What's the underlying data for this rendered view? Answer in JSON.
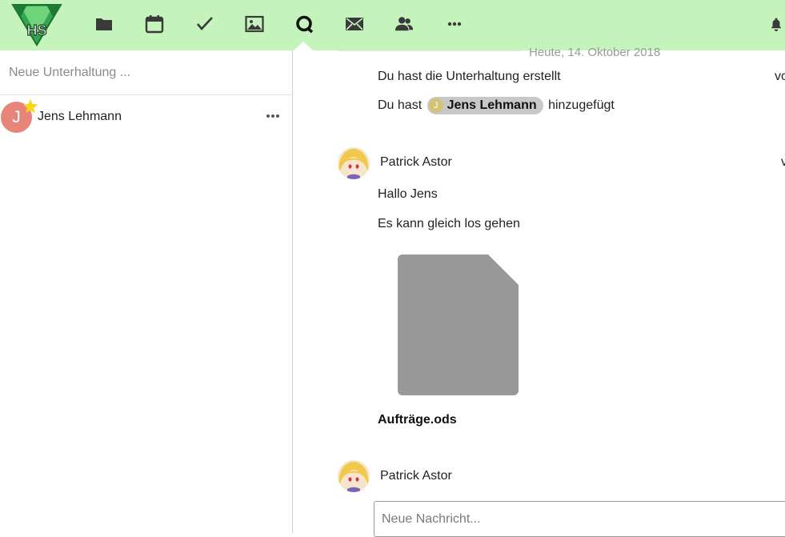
{
  "header": {
    "logo_text": "HS",
    "nav": [
      {
        "name": "files",
        "icon": "folder-icon"
      },
      {
        "name": "calendar",
        "icon": "calendar-icon"
      },
      {
        "name": "tasks",
        "icon": "checkmark-icon"
      },
      {
        "name": "gallery",
        "icon": "image-icon"
      },
      {
        "name": "talk",
        "icon": "talk-icon",
        "active": true
      },
      {
        "name": "mail",
        "icon": "mail-icon"
      },
      {
        "name": "contacts",
        "icon": "contacts-icon"
      },
      {
        "name": "more",
        "icon": "more-icon"
      }
    ],
    "notifications_icon": "bell-icon",
    "colors": {
      "header_bg": "#c4f4bb",
      "icon": "#3a3a3a"
    }
  },
  "sidebar": {
    "new_conversation_placeholder": "Neue Unterhaltung ...",
    "conversations": [
      {
        "avatar_letter": "J",
        "name": "Jens Lehmann",
        "favorite": true,
        "avatar_color": "#e8857a"
      }
    ]
  },
  "chat": {
    "date_separator": "Heute, 14. Oktober 2018",
    "system_messages": [
      {
        "text": "Du hast die Unterhaltung erstellt",
        "right_cut": "vo"
      },
      {
        "prefix": "Du hast",
        "mention_letter": "J",
        "mention_name": "Jens Lehmann",
        "suffix": "hinzugefügt"
      }
    ],
    "messages": [
      {
        "author": "Patrick Astor",
        "right_cut": "v",
        "lines": [
          "Hallo Jens",
          "Es kann gleich los gehen"
        ],
        "file": {
          "name": "Aufträge.ods",
          "icon": "file-icon",
          "color": "#989898"
        }
      },
      {
        "author": "Patrick Astor",
        "lines": []
      }
    ],
    "composer_placeholder": "Neue Nachricht..."
  }
}
